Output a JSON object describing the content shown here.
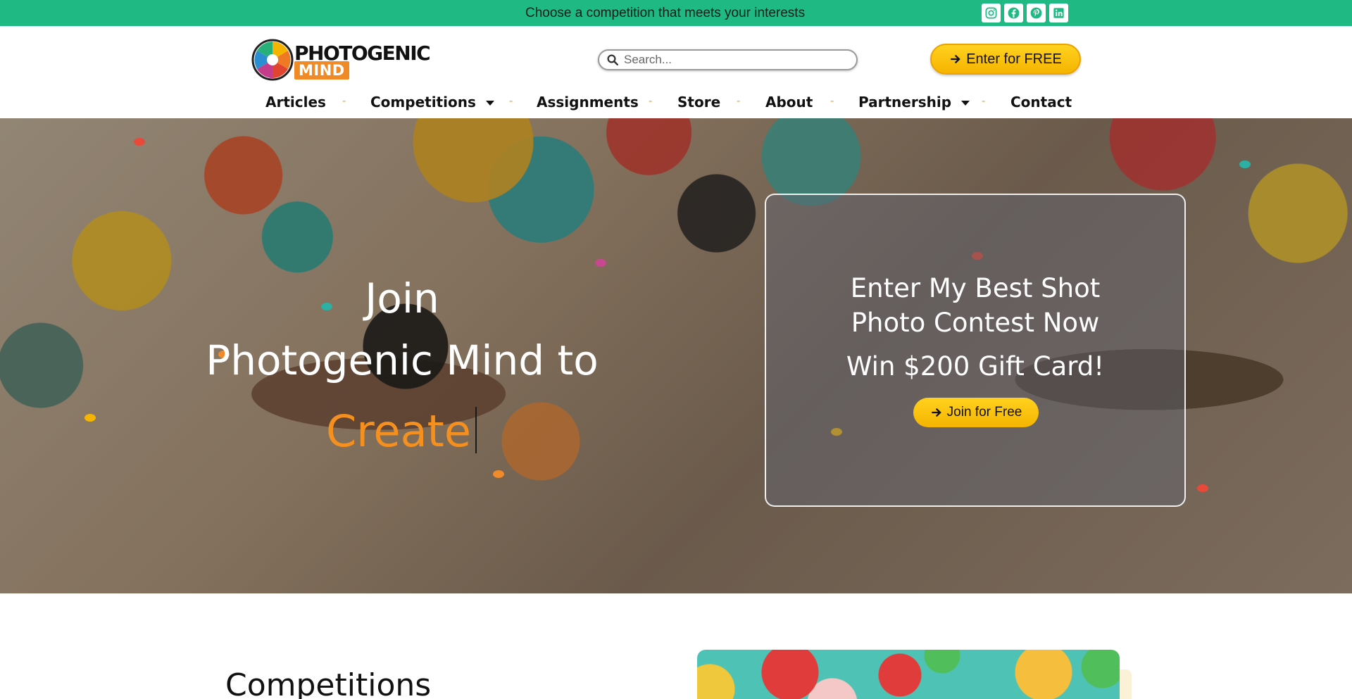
{
  "topbar": {
    "message": "Choose a competition that meets your interests",
    "social": [
      "instagram-icon",
      "facebook-icon",
      "pinterest-icon",
      "linkedin-icon"
    ],
    "background": "#1fba84"
  },
  "header": {
    "logo": {
      "line1": "PHOTOGENIC",
      "line2": "MIND"
    },
    "search": {
      "placeholder": "Search..."
    },
    "cta": {
      "label": "Enter for FREE",
      "icon": "arrow-right-icon"
    }
  },
  "nav": {
    "items": [
      {
        "label": "Articles",
        "dropdown": false
      },
      {
        "label": "Competitions",
        "dropdown": true
      },
      {
        "label": "Assignments",
        "dropdown": false
      },
      {
        "label": "Store",
        "dropdown": false
      },
      {
        "label": "About",
        "dropdown": false
      },
      {
        "label": "Partnership",
        "dropdown": true
      },
      {
        "label": "Contact",
        "dropdown": false
      }
    ],
    "separator": "-"
  },
  "hero": {
    "title_line1": "Join",
    "title_line2": "Photogenic Mind to",
    "typed_word": "Create",
    "card": {
      "title_line1": "Enter My Best Shot",
      "title_line2": "Photo Contest Now",
      "subtitle": "Win $200 Gift Card!",
      "button_label": "Join for Free"
    }
  },
  "section": {
    "title": "Competitions"
  },
  "colors": {
    "accent": "#1fba84",
    "cta": "#f7bd10",
    "highlight": "#f5901f"
  }
}
